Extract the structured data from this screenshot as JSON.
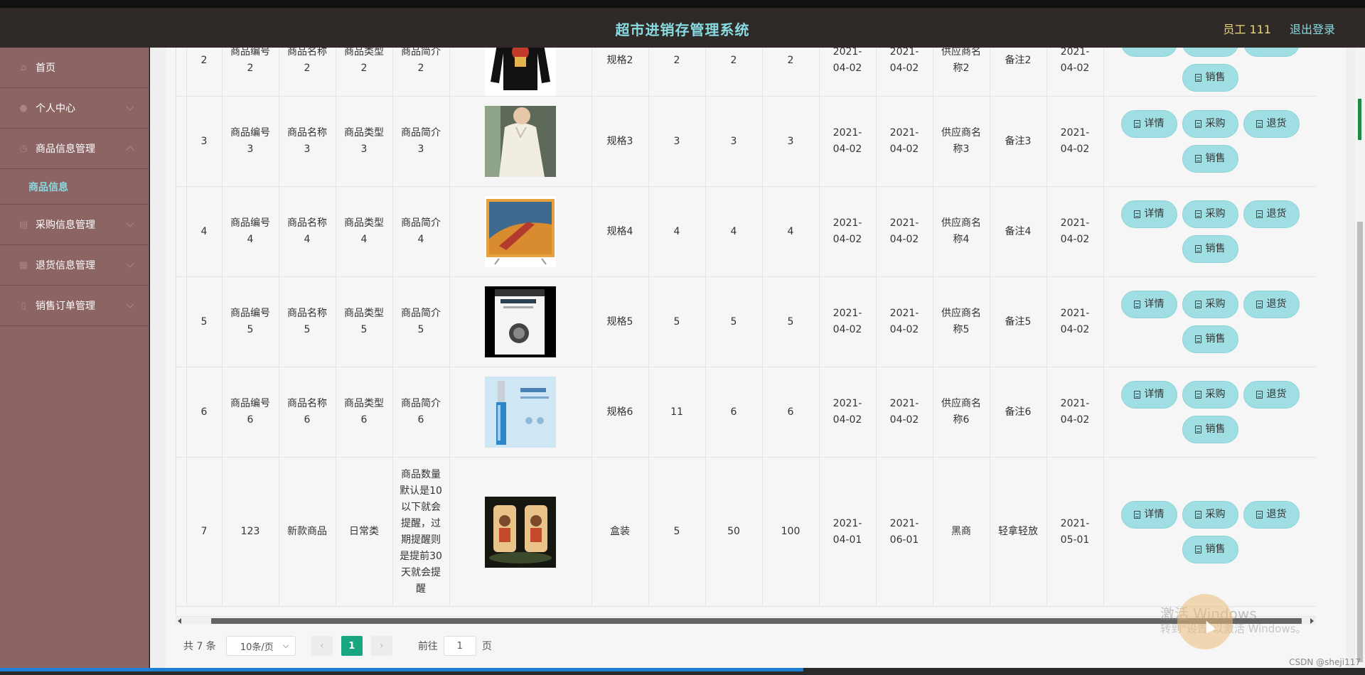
{
  "header": {
    "title": "超市进销存管理系统",
    "user": "员工 111",
    "logout": "退出登录"
  },
  "sidebar": {
    "items": [
      {
        "label": "首页",
        "icon": "home-icon"
      },
      {
        "label": "个人中心",
        "icon": "user-icon"
      },
      {
        "label": "商品信息管理",
        "icon": "goods-icon",
        "expanded": true
      },
      {
        "label": "商品信息",
        "icon": ""
      },
      {
        "label": "采购信息管理",
        "icon": "purchase-icon"
      },
      {
        "label": "退货信息管理",
        "icon": "return-icon"
      },
      {
        "label": "销售订单管理",
        "icon": "sales-icon"
      }
    ]
  },
  "table": {
    "actions": {
      "detail": "详情",
      "purchase": "采购",
      "return": "退货",
      "sell": "销售"
    },
    "rows": [
      {
        "id": "2",
        "code": "商品编号2",
        "name": "商品名称2",
        "type": "商品类型2",
        "intro": "商品简介2",
        "image": "black-sweater",
        "spec": "规格2",
        "n1": "2",
        "n2": "2",
        "n3": "2",
        "date1": "2021-04-02",
        "date2": "2021-04-02",
        "supplier": "供应商名称2",
        "remark": "备注2",
        "date3": "2021-04-02"
      },
      {
        "id": "3",
        "code": "商品编号3",
        "name": "商品名称3",
        "type": "商品类型3",
        "intro": "商品简介3",
        "image": "white-blouse",
        "spec": "规格3",
        "n1": "3",
        "n2": "3",
        "n3": "3",
        "date1": "2021-04-02",
        "date2": "2021-04-02",
        "supplier": "供应商名称3",
        "remark": "备注3",
        "date3": "2021-04-02"
      },
      {
        "id": "4",
        "code": "商品编号4",
        "name": "商品名称4",
        "type": "商品类型4",
        "intro": "商品简介4",
        "image": "tv-screen",
        "spec": "规格4",
        "n1": "4",
        "n2": "4",
        "n3": "4",
        "date1": "2021-04-02",
        "date2": "2021-04-02",
        "supplier": "供应商名称4",
        "remark": "备注4",
        "date3": "2021-04-02"
      },
      {
        "id": "5",
        "code": "商品编号5",
        "name": "商品名称5",
        "type": "商品类型5",
        "intro": "商品简介5",
        "image": "book-cover",
        "spec": "规格5",
        "n1": "5",
        "n2": "5",
        "n3": "5",
        "date1": "2021-04-02",
        "date2": "2021-04-02",
        "supplier": "供应商名称5",
        "remark": "备注5",
        "date3": "2021-04-02"
      },
      {
        "id": "6",
        "code": "商品编号6",
        "name": "商品名称6",
        "type": "商品类型6",
        "intro": "商品简介6",
        "image": "serum-bottle",
        "spec": "规格6",
        "n1": "11",
        "n2": "6",
        "n3": "6",
        "date1": "2021-04-02",
        "date2": "2021-04-02",
        "supplier": "供应商名称6",
        "remark": "备注6",
        "date3": "2021-04-02"
      },
      {
        "id": "7",
        "code": "123",
        "name": "新款商品",
        "type": "日常类",
        "intro": "商品数量默认是10以下就会提醒，过期提醒则是提前30天就会提醒",
        "image": "glass-lamps",
        "spec": "盒装",
        "n1": "5",
        "n2": "50",
        "n3": "100",
        "date1": "2021-04-01",
        "date2": "2021-06-01",
        "supplier": "黑商",
        "remark": "轻拿轻放",
        "date3": "2021-05-01"
      }
    ]
  },
  "pagination": {
    "total": "共 7 条",
    "page_size": "10条/页",
    "current": "1",
    "goto_prefix": "前往",
    "goto_value": "1",
    "goto_suffix": "页"
  },
  "watermark": {
    "line1": "激活 Windows",
    "line2": "转到\"设置\"以激活 Windows。"
  },
  "csdn": "CSDN @sheji117",
  "colors": {
    "header_bg": "#2f2928",
    "sidebar_bg": "#8c6464",
    "accent": "#88dbe0",
    "button_bg": "#9fdfe3",
    "pager_active": "#18a67e"
  }
}
